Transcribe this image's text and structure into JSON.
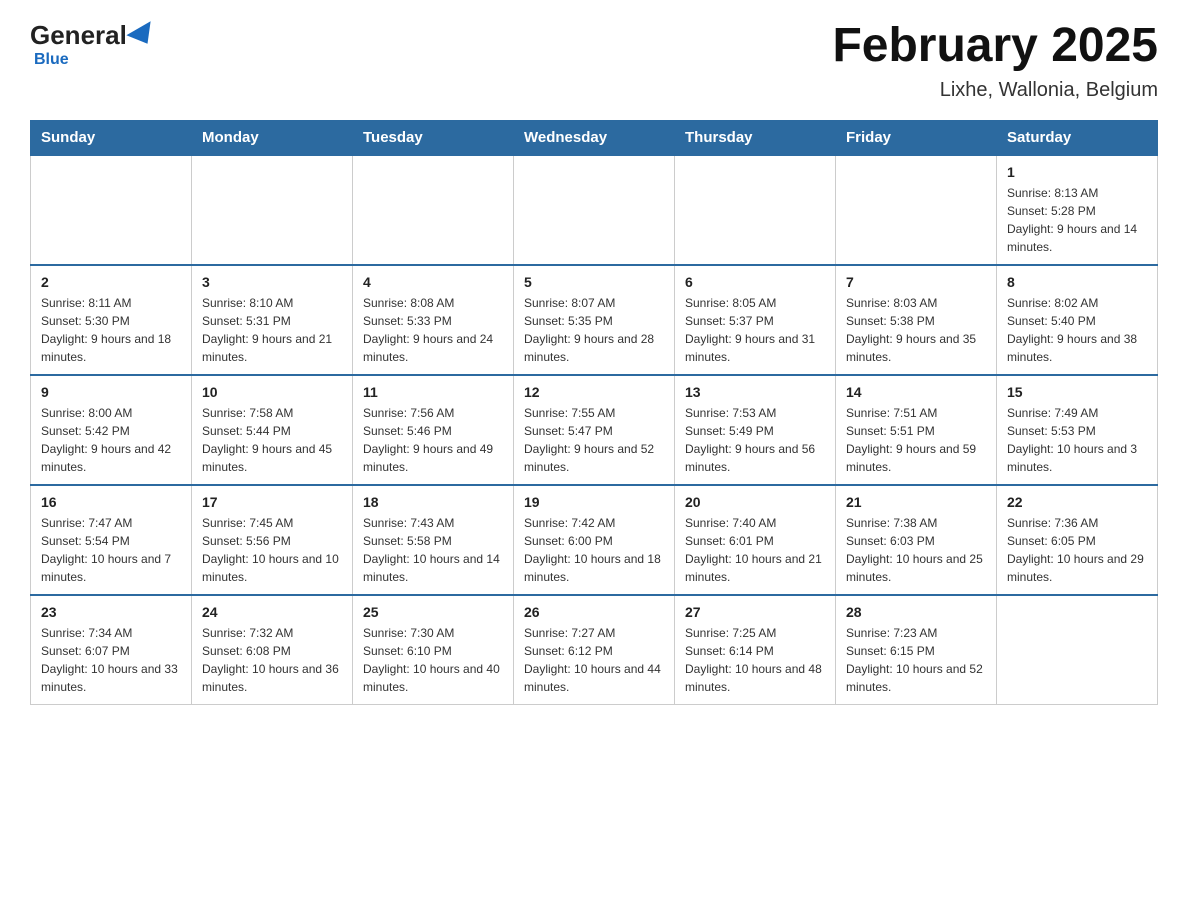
{
  "header": {
    "logo_general": "General",
    "logo_blue": "Blue",
    "month_title": "February 2025",
    "location": "Lixhe, Wallonia, Belgium"
  },
  "days_of_week": [
    "Sunday",
    "Monday",
    "Tuesday",
    "Wednesday",
    "Thursday",
    "Friday",
    "Saturday"
  ],
  "weeks": [
    [
      {
        "day": "",
        "info": ""
      },
      {
        "day": "",
        "info": ""
      },
      {
        "day": "",
        "info": ""
      },
      {
        "day": "",
        "info": ""
      },
      {
        "day": "",
        "info": ""
      },
      {
        "day": "",
        "info": ""
      },
      {
        "day": "1",
        "info": "Sunrise: 8:13 AM\nSunset: 5:28 PM\nDaylight: 9 hours and 14 minutes."
      }
    ],
    [
      {
        "day": "2",
        "info": "Sunrise: 8:11 AM\nSunset: 5:30 PM\nDaylight: 9 hours and 18 minutes."
      },
      {
        "day": "3",
        "info": "Sunrise: 8:10 AM\nSunset: 5:31 PM\nDaylight: 9 hours and 21 minutes."
      },
      {
        "day": "4",
        "info": "Sunrise: 8:08 AM\nSunset: 5:33 PM\nDaylight: 9 hours and 24 minutes."
      },
      {
        "day": "5",
        "info": "Sunrise: 8:07 AM\nSunset: 5:35 PM\nDaylight: 9 hours and 28 minutes."
      },
      {
        "day": "6",
        "info": "Sunrise: 8:05 AM\nSunset: 5:37 PM\nDaylight: 9 hours and 31 minutes."
      },
      {
        "day": "7",
        "info": "Sunrise: 8:03 AM\nSunset: 5:38 PM\nDaylight: 9 hours and 35 minutes."
      },
      {
        "day": "8",
        "info": "Sunrise: 8:02 AM\nSunset: 5:40 PM\nDaylight: 9 hours and 38 minutes."
      }
    ],
    [
      {
        "day": "9",
        "info": "Sunrise: 8:00 AM\nSunset: 5:42 PM\nDaylight: 9 hours and 42 minutes."
      },
      {
        "day": "10",
        "info": "Sunrise: 7:58 AM\nSunset: 5:44 PM\nDaylight: 9 hours and 45 minutes."
      },
      {
        "day": "11",
        "info": "Sunrise: 7:56 AM\nSunset: 5:46 PM\nDaylight: 9 hours and 49 minutes."
      },
      {
        "day": "12",
        "info": "Sunrise: 7:55 AM\nSunset: 5:47 PM\nDaylight: 9 hours and 52 minutes."
      },
      {
        "day": "13",
        "info": "Sunrise: 7:53 AM\nSunset: 5:49 PM\nDaylight: 9 hours and 56 minutes."
      },
      {
        "day": "14",
        "info": "Sunrise: 7:51 AM\nSunset: 5:51 PM\nDaylight: 9 hours and 59 minutes."
      },
      {
        "day": "15",
        "info": "Sunrise: 7:49 AM\nSunset: 5:53 PM\nDaylight: 10 hours and 3 minutes."
      }
    ],
    [
      {
        "day": "16",
        "info": "Sunrise: 7:47 AM\nSunset: 5:54 PM\nDaylight: 10 hours and 7 minutes."
      },
      {
        "day": "17",
        "info": "Sunrise: 7:45 AM\nSunset: 5:56 PM\nDaylight: 10 hours and 10 minutes."
      },
      {
        "day": "18",
        "info": "Sunrise: 7:43 AM\nSunset: 5:58 PM\nDaylight: 10 hours and 14 minutes."
      },
      {
        "day": "19",
        "info": "Sunrise: 7:42 AM\nSunset: 6:00 PM\nDaylight: 10 hours and 18 minutes."
      },
      {
        "day": "20",
        "info": "Sunrise: 7:40 AM\nSunset: 6:01 PM\nDaylight: 10 hours and 21 minutes."
      },
      {
        "day": "21",
        "info": "Sunrise: 7:38 AM\nSunset: 6:03 PM\nDaylight: 10 hours and 25 minutes."
      },
      {
        "day": "22",
        "info": "Sunrise: 7:36 AM\nSunset: 6:05 PM\nDaylight: 10 hours and 29 minutes."
      }
    ],
    [
      {
        "day": "23",
        "info": "Sunrise: 7:34 AM\nSunset: 6:07 PM\nDaylight: 10 hours and 33 minutes."
      },
      {
        "day": "24",
        "info": "Sunrise: 7:32 AM\nSunset: 6:08 PM\nDaylight: 10 hours and 36 minutes."
      },
      {
        "day": "25",
        "info": "Sunrise: 7:30 AM\nSunset: 6:10 PM\nDaylight: 10 hours and 40 minutes."
      },
      {
        "day": "26",
        "info": "Sunrise: 7:27 AM\nSunset: 6:12 PM\nDaylight: 10 hours and 44 minutes."
      },
      {
        "day": "27",
        "info": "Sunrise: 7:25 AM\nSunset: 6:14 PM\nDaylight: 10 hours and 48 minutes."
      },
      {
        "day": "28",
        "info": "Sunrise: 7:23 AM\nSunset: 6:15 PM\nDaylight: 10 hours and 52 minutes."
      },
      {
        "day": "",
        "info": ""
      }
    ]
  ]
}
